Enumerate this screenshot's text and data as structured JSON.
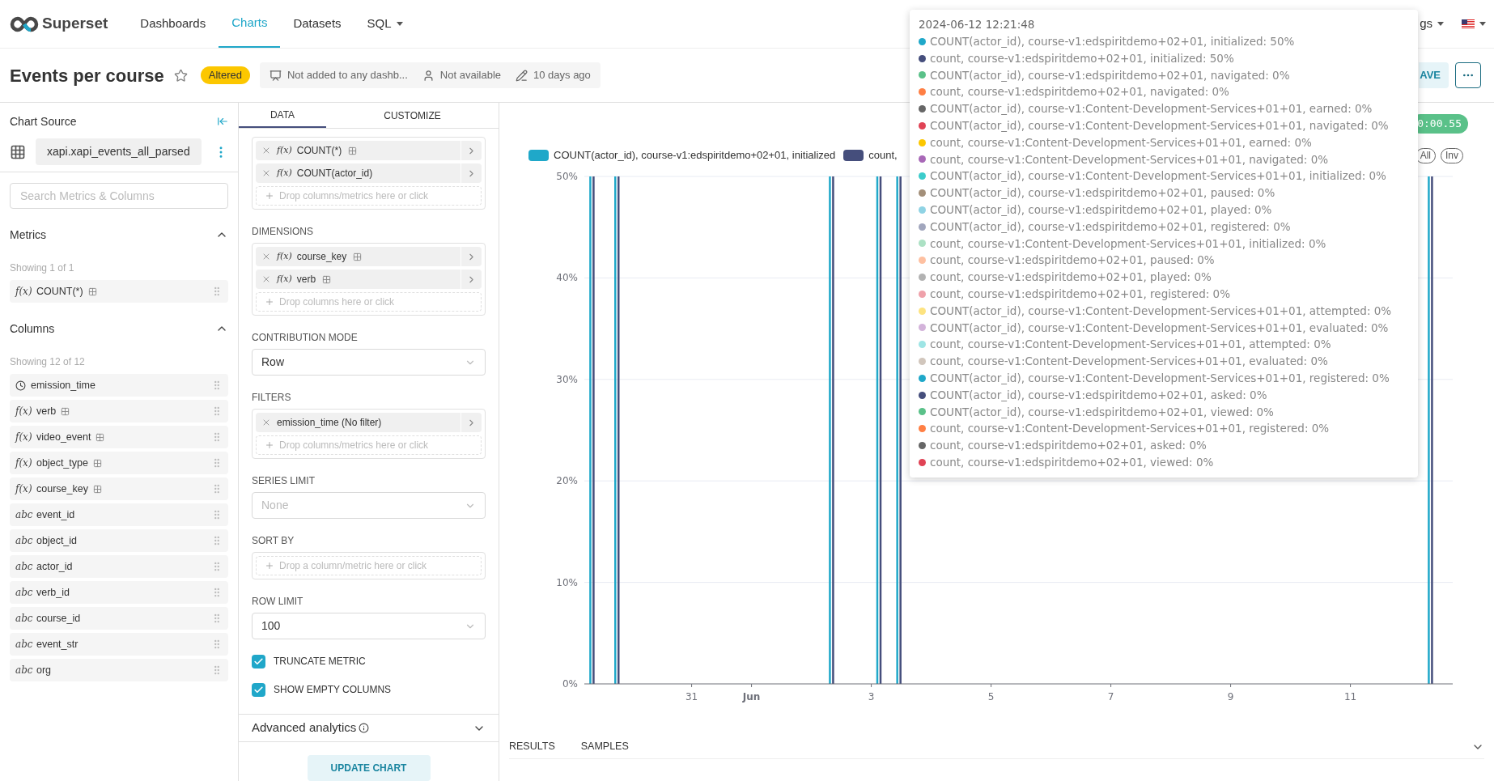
{
  "nav": {
    "logo": "Superset",
    "items": [
      {
        "label": "Dashboards",
        "selected": false,
        "dropdown": false
      },
      {
        "label": "Charts",
        "selected": true,
        "dropdown": false
      },
      {
        "label": "Datasets",
        "selected": false,
        "dropdown": false
      },
      {
        "label": "SQL",
        "selected": false,
        "dropdown": true
      }
    ],
    "settings": "gs"
  },
  "header": {
    "title": "Events per course",
    "starred": false,
    "badge": "Altered",
    "meta": [
      {
        "kind": "dashboard",
        "text": "Not added to any dashb..."
      },
      {
        "kind": "owner",
        "text": "Not available"
      },
      {
        "kind": "modified",
        "text": "10 days ago"
      }
    ],
    "save": "AVE"
  },
  "source": {
    "title": "Chart Source",
    "dataset": "xapi.xapi_events_all_parsed",
    "search_placeholder": "Search Metrics & Columns",
    "sections": [
      {
        "title": "Metrics",
        "expanded": true,
        "count": "Showing 1 of 1",
        "items": [
          {
            "kind": "typed",
            "type_label": "f(x)",
            "name": "COUNT(*)",
            "info": true
          }
        ]
      },
      {
        "title": "Columns",
        "expanded": true,
        "count": "Showing 12 of 12",
        "items": [
          {
            "kind": "time",
            "name": "emission_time",
            "info": false
          },
          {
            "kind": "typed",
            "type_label": "f(x)",
            "name": "verb",
            "info": true
          },
          {
            "kind": "typed",
            "type_label": "f(x)",
            "name": "video_event",
            "info": true
          },
          {
            "kind": "typed",
            "type_label": "f(x)",
            "name": "object_type",
            "info": true
          },
          {
            "kind": "typed",
            "type_label": "f(x)",
            "name": "course_key",
            "info": true
          },
          {
            "kind": "typed",
            "type_label": "abc",
            "name": "event_id",
            "info": false
          },
          {
            "kind": "typed",
            "type_label": "abc",
            "name": "object_id",
            "info": false
          },
          {
            "kind": "typed",
            "type_label": "abc",
            "name": "actor_id",
            "info": false
          },
          {
            "kind": "typed",
            "type_label": "abc",
            "name": "verb_id",
            "info": false
          },
          {
            "kind": "typed",
            "type_label": "abc",
            "name": "course_id",
            "info": false
          },
          {
            "kind": "typed",
            "type_label": "abc",
            "name": "event_str",
            "info": false
          },
          {
            "kind": "typed",
            "type_label": "abc",
            "name": "org",
            "info": false
          }
        ]
      }
    ]
  },
  "controls": {
    "tabs": [
      {
        "label": "DATA",
        "selected": true
      },
      {
        "label": "CUSTOMIZE",
        "selected": false
      }
    ],
    "sections": [
      {
        "kind": "drop",
        "items": [
          {
            "type_label": "f(x)",
            "name": "COUNT(*)",
            "info": true
          },
          {
            "type_label": "f(x)",
            "name": "COUNT(actor_id)",
            "info": false
          }
        ],
        "placeholder": "Drop columns/metrics here or click"
      },
      {
        "kind": "drop",
        "label": "DIMENSIONS",
        "items": [
          {
            "type_label": "f(x)",
            "name": "course_key",
            "info": true
          },
          {
            "type_label": "f(x)",
            "name": "verb",
            "info": true
          }
        ],
        "placeholder": "Drop columns here or click"
      },
      {
        "kind": "select",
        "label": "CONTRIBUTION MODE",
        "value": "Row"
      },
      {
        "kind": "drop",
        "label": "FILTERS",
        "items": [
          {
            "name": "emission_time (No filter)",
            "info": false
          }
        ],
        "placeholder": "Drop columns/metrics here or click"
      },
      {
        "kind": "select",
        "label": "SERIES LIMIT",
        "placeholder": "None"
      },
      {
        "kind": "drop",
        "label": "SORT BY",
        "placeholder": "Drop a column/metric here or click"
      },
      {
        "kind": "select",
        "label": "ROW LIMIT",
        "value": "100"
      },
      {
        "kind": "checkbox",
        "label": "TRUNCATE METRIC",
        "checked": true
      },
      {
        "kind": "checkbox",
        "label": "SHOW EMPTY COLUMNS",
        "checked": true
      }
    ],
    "advanced": {
      "label": "Advanced analytics",
      "expanded": false
    },
    "update_button": "UPDATE CHART"
  },
  "chart": {
    "timer": "0:00.55",
    "legend_controls": [
      "All",
      "Inv"
    ],
    "chart_data": {
      "type": "bar",
      "grid": true,
      "x": [
        "2024-05-29T07:00",
        "2024-05-29T17:00",
        "2024-06-02T07:00",
        "2024-06-03T02:00",
        "2024-06-03T10:00",
        "2024-06-12T07:00"
      ],
      "xlim": [
        "2024-05-29T05:00",
        "2024-06-12T17:00"
      ],
      "ylim": [
        0,
        0.5
      ],
      "xticks": [
        {
          "value": "2024-05-31",
          "label": "31"
        },
        {
          "value": "2024-06-01",
          "label": "Jun"
        },
        {
          "value": "2024-06-03",
          "label": "3"
        },
        {
          "value": "2024-06-05",
          "label": "5"
        },
        {
          "value": "2024-06-07",
          "label": "7"
        },
        {
          "value": "2024-06-09",
          "label": "9"
        },
        {
          "value": "2024-06-11",
          "label": "11"
        }
      ],
      "yticks": [
        {
          "value": 0,
          "label": "0%"
        },
        {
          "value": 0.1,
          "label": "10%"
        },
        {
          "value": 0.2,
          "label": "20%"
        },
        {
          "value": 0.3,
          "label": "30%"
        },
        {
          "value": 0.4,
          "label": "40%"
        },
        {
          "value": 0.5,
          "label": "50%"
        }
      ],
      "series": [
        {
          "name": "COUNT(actor_id), course-v1:edspiritdemo+02+01, initialized",
          "color": "#1fa8c9",
          "values": [
            0.5,
            0.5,
            0.5,
            0.5,
            0.5,
            0.5
          ]
        },
        {
          "name": "count,",
          "color": "#454e7c",
          "values": [
            0.5,
            0.5,
            0.5,
            0.5,
            0.5,
            0.5
          ]
        }
      ]
    },
    "tooltip": {
      "title": "2024-06-12 12:21:48",
      "rows": [
        {
          "text": "COUNT(actor_id), course-v1:edspiritdemo+02+01, initialized: 50%",
          "color": "#1fa8c9"
        },
        {
          "text": "count, course-v1:edspiritdemo+02+01, initialized: 50%",
          "color": "#454e7c"
        },
        {
          "text": "COUNT(actor_id), course-v1:edspiritdemo+02+01, navigated: 0%",
          "color": "#5ac189"
        },
        {
          "text": "count, course-v1:edspiritdemo+02+01, navigated: 0%",
          "color": "#ff7f44"
        },
        {
          "text": "COUNT(actor_id), course-v1:Content-Development-Services+01+01, earned: 0%",
          "color": "#666666"
        },
        {
          "text": "COUNT(actor_id), course-v1:Content-Development-Services+01+01, navigated: 0%",
          "color": "#e04355"
        },
        {
          "text": "count, course-v1:Content-Development-Services+01+01, earned: 0%",
          "color": "#fcc700"
        },
        {
          "text": "count, course-v1:Content-Development-Services+01+01, navigated: 0%",
          "color": "#a868b7"
        },
        {
          "text": "COUNT(actor_id), course-v1:Content-Development-Services+01+01, initialized: 0%",
          "color": "#3ccccb"
        },
        {
          "text": "COUNT(actor_id), course-v1:edspiritdemo+02+01, paused: 0%",
          "color": "#a38f79"
        },
        {
          "text": "COUNT(actor_id), course-v1:edspiritdemo+02+01, played: 0%",
          "color": "#8fd3e4"
        },
        {
          "text": "COUNT(actor_id), course-v1:edspiritdemo+02+01, registered: 0%",
          "color": "#a1a6bd"
        },
        {
          "text": "count, course-v1:Content-Development-Services+01+01, initialized: 0%",
          "color": "#ace1c4"
        },
        {
          "text": "count, course-v1:edspiritdemo+02+01, paused: 0%",
          "color": "#fec0a1"
        },
        {
          "text": "count, course-v1:edspiritdemo+02+01, played: 0%",
          "color": "#b2b2b2"
        },
        {
          "text": "count, course-v1:edspiritdemo+02+01, registered: 0%",
          "color": "#efa1aa"
        },
        {
          "text": "COUNT(actor_id), course-v1:Content-Development-Services+01+01, attempted: 0%",
          "color": "#fde380"
        },
        {
          "text": "COUNT(actor_id), course-v1:Content-Development-Services+01+01, evaluated: 0%",
          "color": "#d3b3da"
        },
        {
          "text": "count, course-v1:Content-Development-Services+01+01, attempted: 0%",
          "color": "#9ee5e5"
        },
        {
          "text": "count, course-v1:Content-Development-Services+01+01, evaluated: 0%",
          "color": "#d1c6bc"
        },
        {
          "text": "COUNT(actor_id), course-v1:Content-Development-Services+01+01, registered: 0%",
          "color": "#1fa8c9"
        },
        {
          "text": "COUNT(actor_id), course-v1:edspiritdemo+02+01, asked: 0%",
          "color": "#454e7c"
        },
        {
          "text": "COUNT(actor_id), course-v1:edspiritdemo+02+01, viewed: 0%",
          "color": "#5ac189"
        },
        {
          "text": "count, course-v1:Content-Development-Services+01+01, registered: 0%",
          "color": "#ff7f44"
        },
        {
          "text": "count, course-v1:edspiritdemo+02+01, asked: 0%",
          "color": "#666666"
        },
        {
          "text": "count, course-v1:edspiritdemo+02+01, viewed: 0%",
          "color": "#e04355"
        }
      ]
    },
    "bottom_tabs": [
      "RESULTS",
      "SAMPLES"
    ],
    "results_expanded": false
  }
}
